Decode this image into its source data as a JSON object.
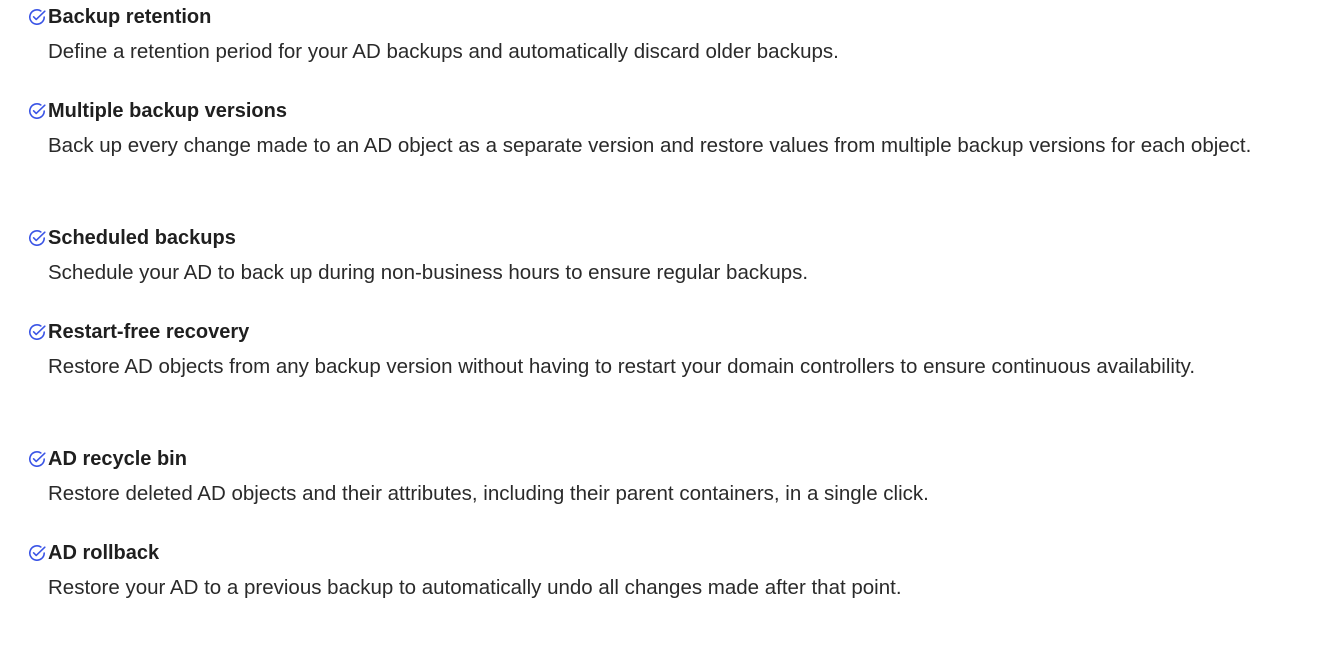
{
  "features": [
    {
      "icon": "check-circle-icon",
      "title": "Backup retention",
      "description": "Define a retention period for your AD backups and automatically discard older backups."
    },
    {
      "icon": "check-circle-icon",
      "title": "Multiple backup versions",
      "description": "Back up every change made to an AD object as a separate version and restore values from multiple backup versions for each object."
    },
    {
      "icon": "check-circle-icon",
      "title": "Scheduled backups",
      "description": "Schedule your AD to back up during non-business hours to ensure regular backups."
    },
    {
      "icon": "check-circle-icon",
      "title": "Restart-free recovery",
      "description": "Restore AD objects from any backup version without having to restart your domain controllers to ensure continuous availability."
    },
    {
      "icon": "check-circle-icon",
      "title": "AD recycle bin",
      "description": "Restore deleted AD objects and their attributes, including their parent containers, in a single click."
    },
    {
      "icon": "check-circle-icon",
      "title": "AD rollback",
      "description": "Restore your AD to a previous backup to automatically undo all changes made after that point."
    }
  ],
  "colors": {
    "icon": "#3b55e6",
    "title": "#1f1f1f",
    "text": "#2a2a2a"
  }
}
